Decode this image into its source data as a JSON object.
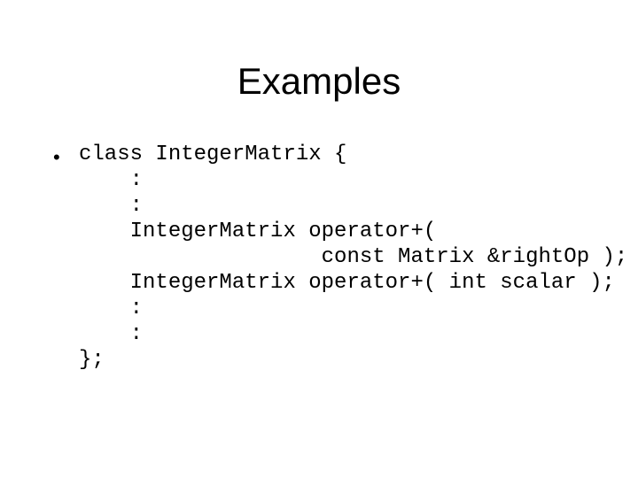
{
  "slide": {
    "title": "Examples",
    "bullet_glyph": "•",
    "code_lines": [
      "class IntegerMatrix {",
      "    :",
      "    :",
      "    IntegerMatrix operator+(",
      "                   const Matrix &rightOp );",
      "    IntegerMatrix operator+( int scalar );",
      "    :",
      "    :",
      "};"
    ]
  }
}
